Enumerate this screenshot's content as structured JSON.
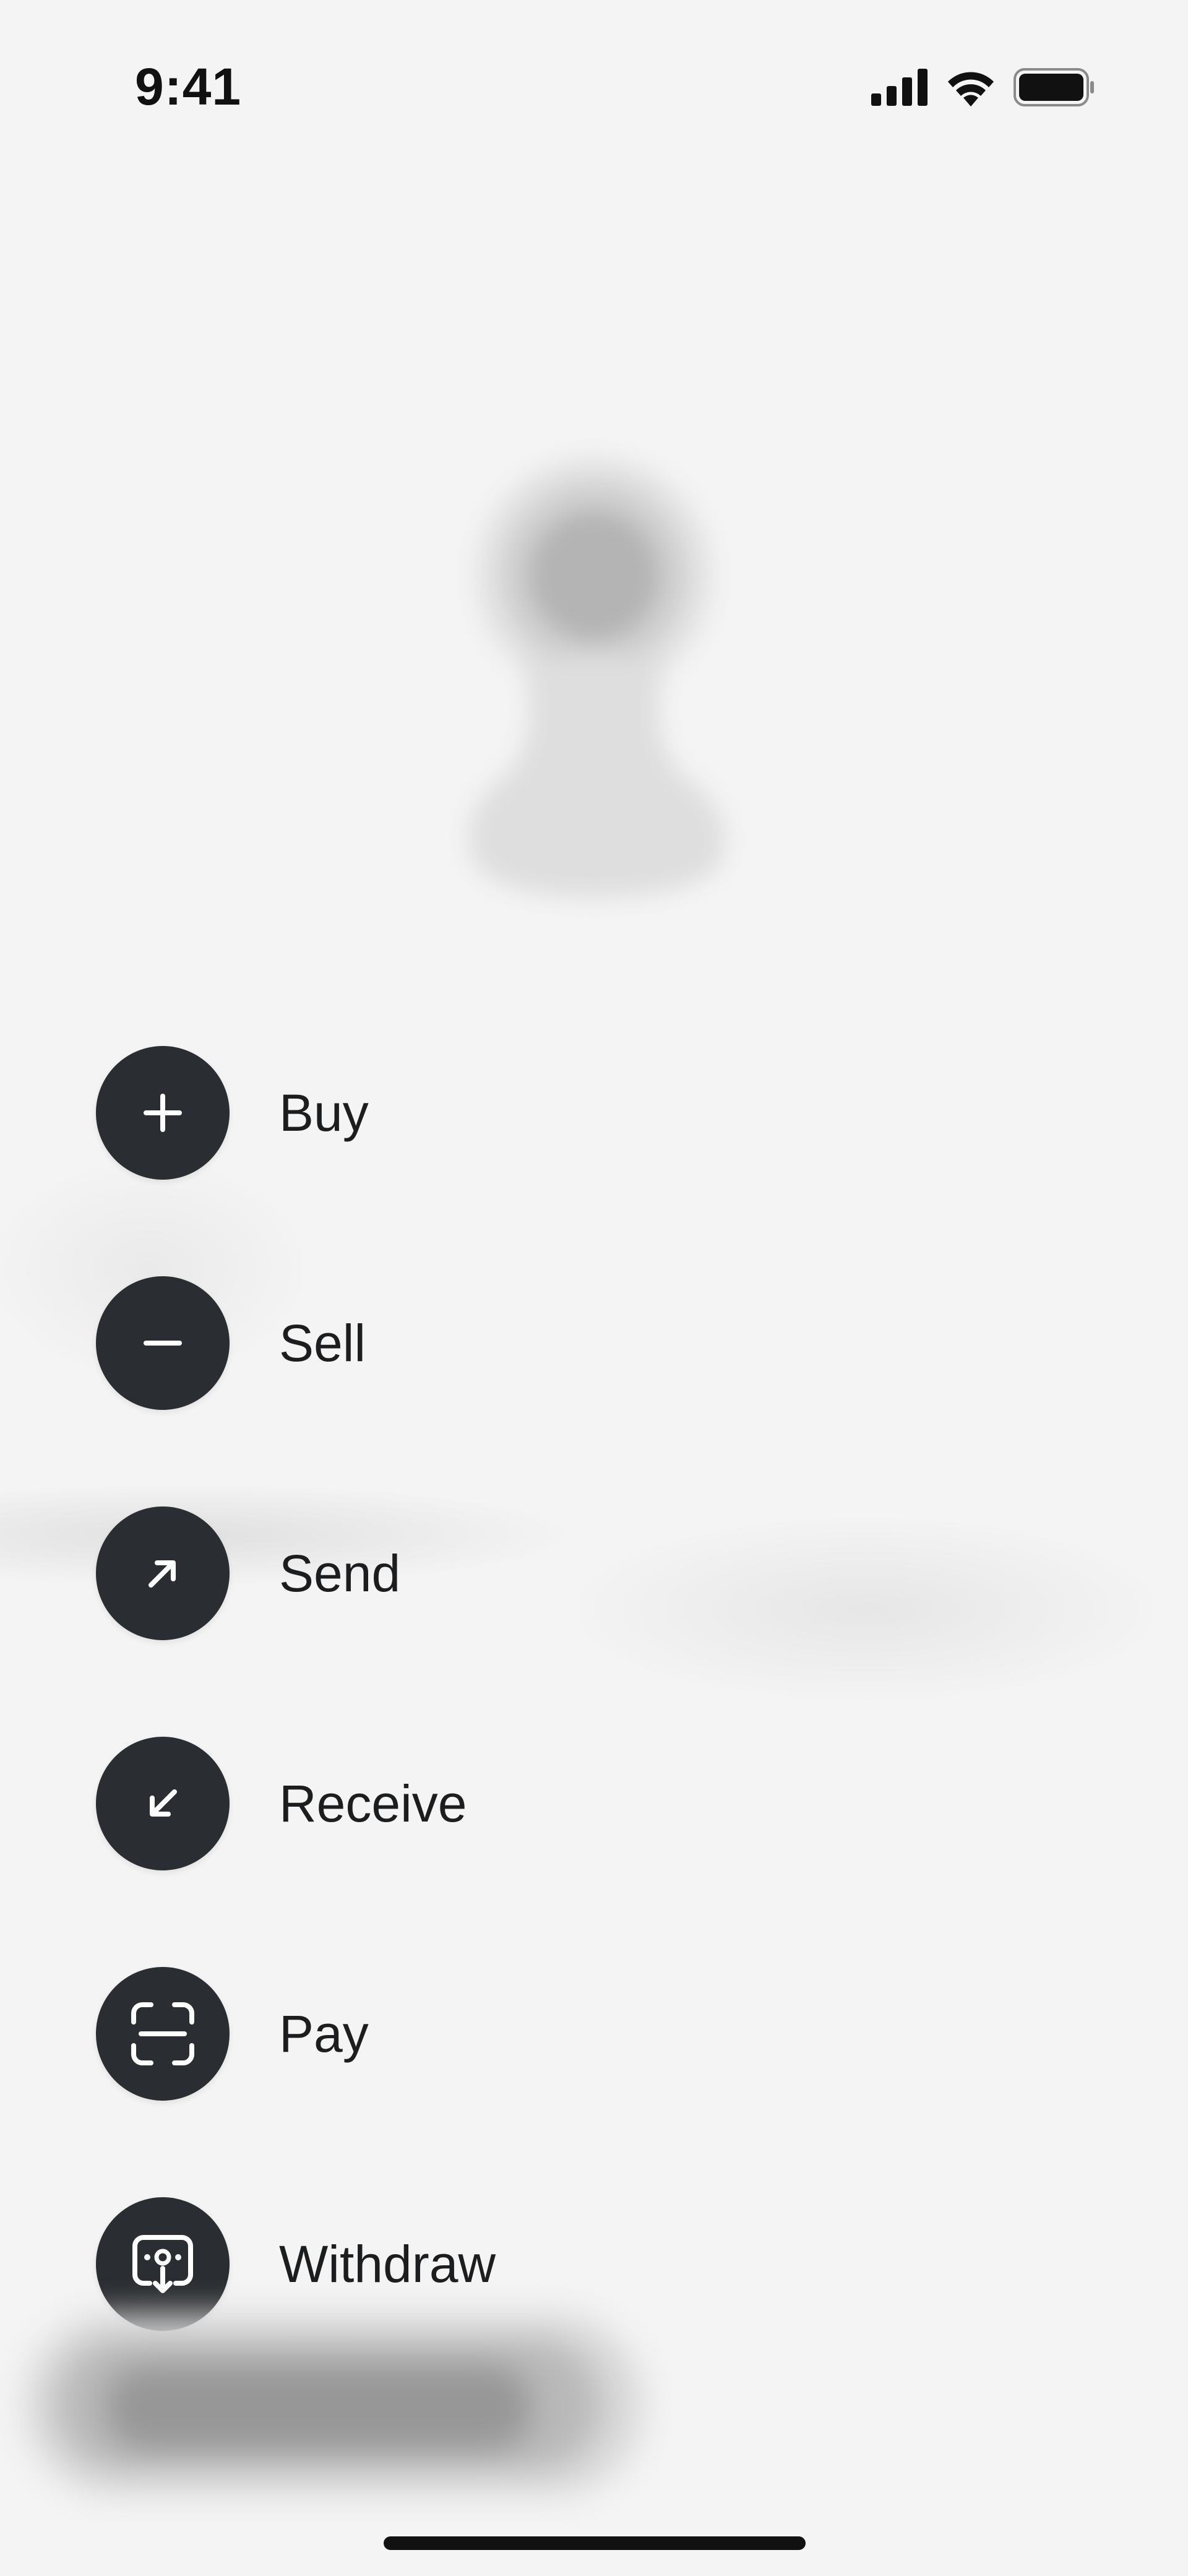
{
  "status_bar": {
    "time": "9:41"
  },
  "icons": {
    "signal": "cellular-signal-icon",
    "wifi": "wifi-icon",
    "battery": "battery-icon"
  },
  "actions": [
    {
      "id": "buy",
      "label": "Buy",
      "icon": "plus-icon"
    },
    {
      "id": "sell",
      "label": "Sell",
      "icon": "minus-icon"
    },
    {
      "id": "send",
      "label": "Send",
      "icon": "arrow-up-right-icon"
    },
    {
      "id": "receive",
      "label": "Receive",
      "icon": "arrow-down-left-icon"
    },
    {
      "id": "pay",
      "label": "Pay",
      "icon": "scan-icon"
    },
    {
      "id": "withdraw",
      "label": "Withdraw",
      "icon": "withdraw-icon"
    }
  ],
  "colors": {
    "background": "#f4f4f4",
    "action_button": "#2a2d31",
    "icon": "#ffffff",
    "text": "#1c1d1f"
  }
}
